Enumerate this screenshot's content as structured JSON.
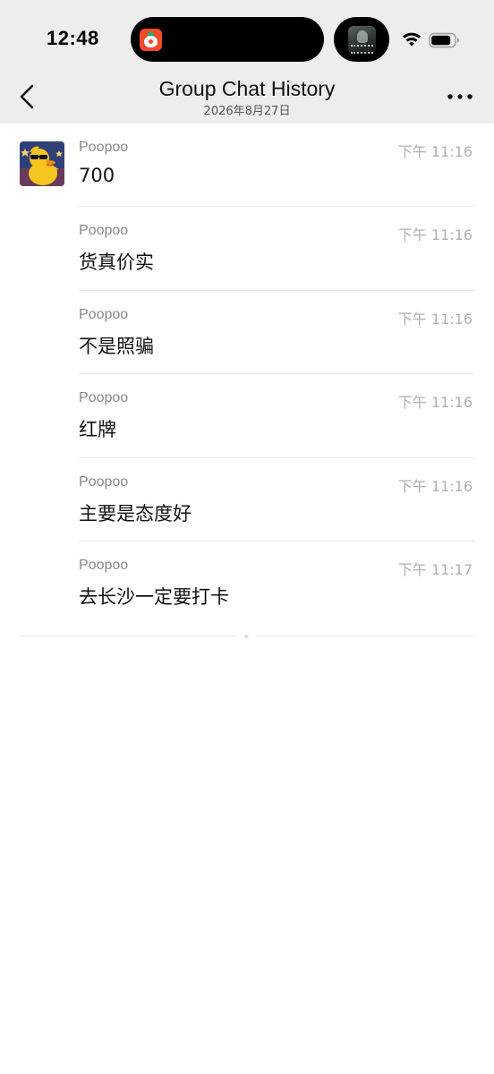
{
  "status_bar": {
    "time": "12:48",
    "wifi_icon": "wifi-icon",
    "battery_icon": "battery-icon"
  },
  "nav": {
    "title": "Group Chat History",
    "subtitle": "2026年8月27日",
    "back_icon": "chevron-left-icon",
    "more_icon": "more-dots-icon"
  },
  "messages": [
    {
      "sender": "Poopoo",
      "time": "下午 11:16",
      "text": "700",
      "show_avatar": true
    },
    {
      "sender": "Poopoo",
      "time": "下午 11:16",
      "text": "货真价实",
      "show_avatar": false
    },
    {
      "sender": "Poopoo",
      "time": "下午 11:16",
      "text": "不是照骗",
      "show_avatar": false
    },
    {
      "sender": "Poopoo",
      "time": "下午 11:16",
      "text": "红牌",
      "show_avatar": false
    },
    {
      "sender": "Poopoo",
      "time": "下午 11:16",
      "text": "主要是态度好",
      "show_avatar": false
    },
    {
      "sender": "Poopoo",
      "time": "下午 11:17",
      "text": "去长沙一定要打卡",
      "show_avatar": false
    }
  ],
  "colors": {
    "header_bg": "#ededed",
    "body_bg": "#ffffff",
    "sender": "#888888",
    "timestamp": "#b0b0b0",
    "message_text": "#111111"
  }
}
